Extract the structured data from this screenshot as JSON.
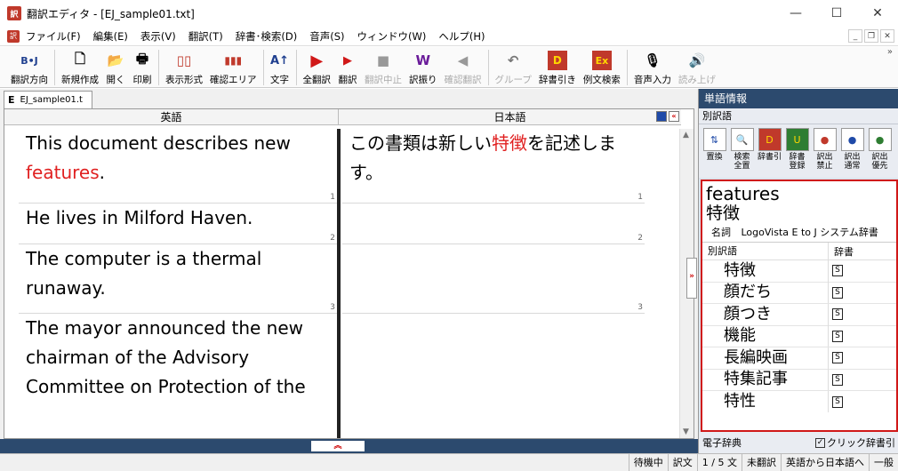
{
  "window": {
    "title": "翻訳エディタ - [EJ_sample01.txt]",
    "app_icon": "訳",
    "min": "—",
    "max": "☐",
    "close": "✕"
  },
  "menu": {
    "items": [
      "ファイル(F)",
      "編集(E)",
      "表示(V)",
      "翻訳(T)",
      "辞書･検索(D)",
      "音声(S)",
      "ウィンドウ(W)",
      "ヘルプ(H)"
    ],
    "mdi_min": "_",
    "mdi_restore": "❐",
    "mdi_close": "✕"
  },
  "toolbar": {
    "buttons": [
      {
        "label": "翻訳方向",
        "icon": "B•J",
        "disabled": false
      },
      {
        "label": "新規作成",
        "icon": "🗋",
        "disabled": false
      },
      {
        "label": "開く",
        "icon": "📂",
        "disabled": false
      },
      {
        "label": "印刷",
        "icon": "🖶",
        "disabled": false
      },
      {
        "label": "表示形式",
        "icon": "▯▯",
        "disabled": false
      },
      {
        "label": "確認エリア",
        "icon": "▮▮▮",
        "disabled": false
      },
      {
        "label": "文字",
        "icon": "A↑",
        "disabled": false
      },
      {
        "label": "全翻訳",
        "icon": "▶",
        "disabled": false
      },
      {
        "label": "翻訳",
        "icon": "▶",
        "disabled": false
      },
      {
        "label": "翻訳中止",
        "icon": "■",
        "disabled": true
      },
      {
        "label": "訳振り",
        "icon": "W",
        "disabled": false
      },
      {
        "label": "確認翻訳",
        "icon": "◀",
        "disabled": true
      },
      {
        "label": "グループ",
        "icon": "↶",
        "disabled": true
      },
      {
        "label": "辞書引き",
        "icon": "D",
        "disabled": false
      },
      {
        "label": "例文検索",
        "icon": "Ex",
        "disabled": false
      },
      {
        "label": "音声入力",
        "icon": "🎙",
        "disabled": false
      },
      {
        "label": "読み上げ",
        "icon": "🔊",
        "disabled": true
      }
    ],
    "more": "»"
  },
  "document": {
    "tab_prefix": "E",
    "tab_label": "EJ_sample01.t",
    "col_en": "英語",
    "col_ja": "日本語",
    "segments": [
      {
        "en_pre": "This document describes new ",
        "en_hl": "features",
        "en_post": ".",
        "ja_pre": "この書類は新しい",
        "ja_hl": "特徴",
        "ja_post": "を記述します。",
        "num": "1"
      },
      {
        "en_pre": "He lives in Milford Haven.",
        "en_hl": "",
        "en_post": "",
        "ja_pre": "",
        "ja_hl": "",
        "ja_post": "",
        "num": "2"
      },
      {
        "en_pre": "The computer is a thermal runaway.",
        "en_hl": "",
        "en_post": "",
        "ja_pre": "",
        "ja_hl": "",
        "ja_post": "",
        "num": "3"
      },
      {
        "en_pre": "The mayor announced the new chairman of the Advisory Committee on Protection of the",
        "en_hl": "",
        "en_post": "",
        "ja_pre": "",
        "ja_hl": "",
        "ja_post": "",
        "num": ""
      }
    ]
  },
  "panel": {
    "title": "単語情報",
    "sub": "別訳語",
    "tools": [
      {
        "label": "置換",
        "icon": "⇅"
      },
      {
        "label": "検索\n全置",
        "icon": "🔍"
      },
      {
        "label": "辞書引",
        "icon": "D"
      },
      {
        "label": "辞書\n登録",
        "icon": "U"
      },
      {
        "label": "訳出\n禁止",
        "icon": "●"
      },
      {
        "label": "訳出\n通常",
        "icon": "●"
      },
      {
        "label": "訳出\n優先",
        "icon": "●"
      }
    ],
    "word": "features",
    "reading": "特徴",
    "pos": "名詞",
    "dict_name": "LogoVista E to J システム辞書",
    "col_alt": "別訳語",
    "col_dict": "辞書",
    "alts": [
      "特徴",
      "顔だち",
      "顔つき",
      "機能",
      "長編映画",
      "特集記事",
      "特性"
    ],
    "dict_mark": "S",
    "footer_left": "電子辞典",
    "footer_check": "クリック辞書引",
    "check_mark": "✓"
  },
  "status": {
    "cells": [
      "待機中",
      "訳文",
      "1 / 5 文",
      "未翻訳",
      "英語から日本語へ",
      "一般"
    ]
  }
}
